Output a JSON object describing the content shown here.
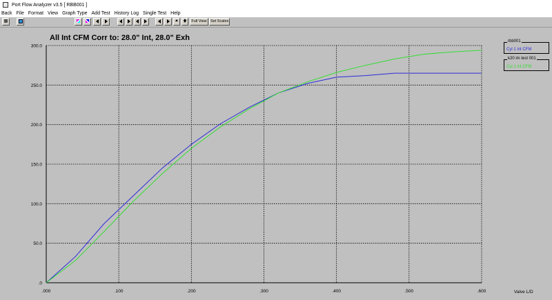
{
  "window": {
    "title": "Port Flow Analyzer v3.5  [ RBB001 ]"
  },
  "menu": [
    "Back",
    "File",
    "Format",
    "View",
    "Graph Type",
    "Add Test",
    "History Log",
    "Single Test",
    "Help"
  ],
  "toolbar": {
    "full_view": "Full View",
    "set_scales": "Set Scales"
  },
  "chart_data": {
    "type": "line",
    "title": "All Int CFM   Corr to: 28.0\" Int, 28.0\" Exh",
    "xlabel": "Valve L/D",
    "ylabel": "",
    "xlim": [
      0,
      0.6
    ],
    "ylim": [
      0,
      300
    ],
    "xticks": [
      ".000",
      ".100",
      ".200",
      ".300",
      ".400",
      ".500",
      ".600"
    ],
    "yticks": [
      ".0",
      "50.0",
      "100.0",
      "150.0",
      "200.0",
      "250.0",
      "300.0"
    ],
    "grid": true,
    "series": [
      {
        "name": "Cyl 1 int CFM",
        "test": "rbb001",
        "color": "#2a2ad8",
        "x": [
          0,
          0.04,
          0.08,
          0.12,
          0.16,
          0.2,
          0.24,
          0.28,
          0.32,
          0.36,
          0.4,
          0.44,
          0.48,
          0.52,
          0.56,
          0.6
        ],
        "y": [
          0,
          33,
          75,
          110,
          145,
          175,
          201,
          222,
          240,
          252,
          260,
          262,
          265,
          265,
          265,
          265
        ]
      },
      {
        "name": "Cyl 1 int CFM",
        "test": "k20 im test 001",
        "color": "#33dd33",
        "x": [
          0,
          0.04,
          0.08,
          0.12,
          0.16,
          0.2,
          0.24,
          0.28,
          0.32,
          0.36,
          0.4,
          0.44,
          0.48,
          0.52,
          0.56,
          0.6
        ],
        "y": [
          0,
          28,
          65,
          103,
          138,
          170,
          197,
          220,
          240,
          254,
          266,
          275,
          283,
          289,
          292,
          294
        ]
      }
    ]
  }
}
